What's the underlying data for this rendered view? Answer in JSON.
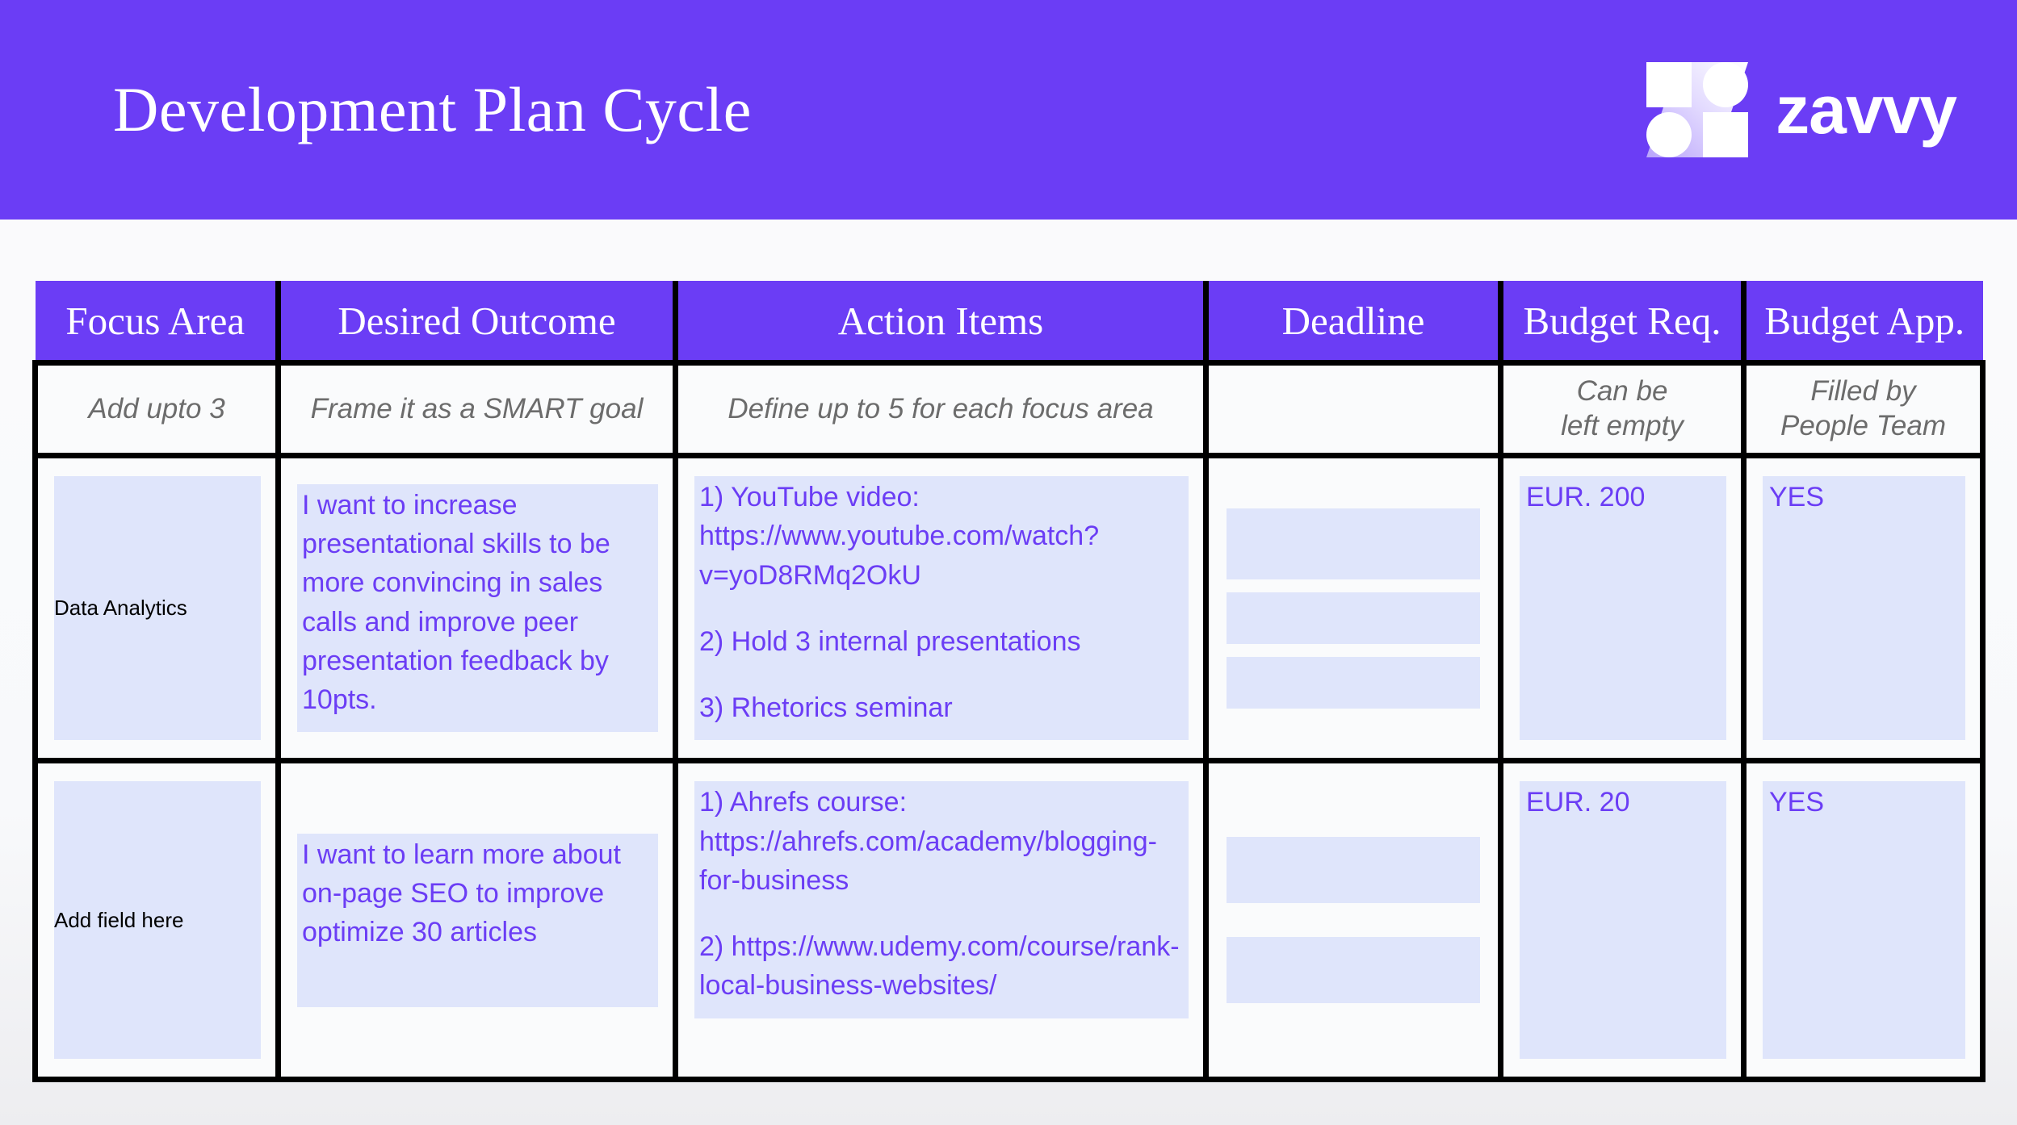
{
  "banner": {
    "title": "Development Plan Cycle",
    "brand_name": "zavvy",
    "logo_icon": "zavvy-z-logo-icon",
    "background_color": "#6b3df5"
  },
  "colors": {
    "brand_purple": "#6b3df5",
    "chip_blue": "#dfe5fb",
    "text_purple": "#6b3df5",
    "hint_gray": "#6c6c6c",
    "border_black": "#000000",
    "page_background": "#fafbfc"
  },
  "table": {
    "headers": [
      "Focus Area",
      "Desired Outcome",
      "Action Items",
      "Deadline",
      "Budget Req.",
      "Budget App."
    ],
    "hints": [
      "Add upto 3",
      "Frame it as a SMART goal",
      "Define up to 5 for each focus area",
      "",
      "Can be\nleft empty",
      "Filled by\nPeople Team"
    ],
    "rows": [
      {
        "focus_area": "Data Analytics",
        "desired_outcome": "I want to increase presentational skills to be more convincing in sales calls and improve peer presentation feedback by 10pts.",
        "action_items": [
          "1) YouTube video: https://www.youtube.com/watch?v=yoD8RMq2OkU",
          "2) Hold 3 internal presentations",
          "3) Rhetorics seminar"
        ],
        "deadline_slots": 3,
        "deadline": "",
        "budget_requested": "EUR. 200",
        "budget_approved": "YES"
      },
      {
        "focus_area": "Add field here",
        "desired_outcome": "I want to learn more about on-page SEO to improve optimize 30 articles",
        "action_items": [
          "1) Ahrefs course: https://ahrefs.com/academy/blogging-for-business",
          "2) https://www.udemy.com/course/rank-local-business-websites/"
        ],
        "deadline_slots": 2,
        "deadline": "",
        "budget_requested": "EUR. 20",
        "budget_approved": "YES"
      }
    ]
  }
}
